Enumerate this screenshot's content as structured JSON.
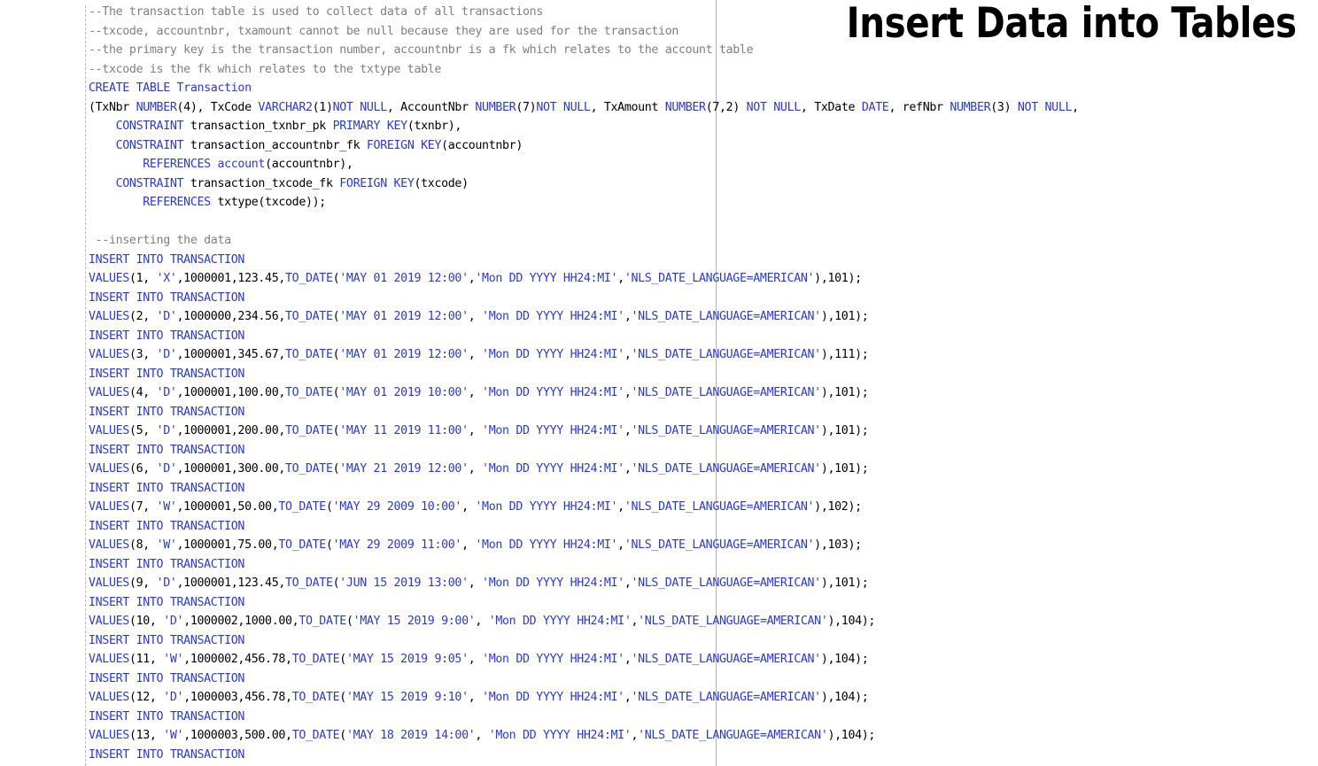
{
  "slide": {
    "title": "Insert Data into Tables"
  },
  "colors": {
    "keyword": "#2b3bc9",
    "comment": "#7f7f7f",
    "plain": "#000000",
    "background": "#ffffff"
  },
  "editor": {
    "lines": [
      [
        {
          "t": "comment",
          "v": "--The transaction table is used to collect data of all transactions"
        }
      ],
      [
        {
          "t": "comment",
          "v": "--txcode, accountnbr, txamount cannot be null because they are used for the transaction"
        }
      ],
      [
        {
          "t": "comment",
          "v": "--the primary key is the transaction number, accountnbr is a fk which relates to the account table"
        }
      ],
      [
        {
          "t": "comment",
          "v": "--txcode is the fk which relates to the txtype table"
        }
      ],
      [
        {
          "t": "kw",
          "v": "CREATE TABLE Transaction"
        }
      ],
      [
        {
          "t": "plain",
          "v": "(TxNbr "
        },
        {
          "t": "kw",
          "v": "NUMBER"
        },
        {
          "t": "plain",
          "v": "(4), TxCode "
        },
        {
          "t": "kw",
          "v": "VARCHAR2"
        },
        {
          "t": "plain",
          "v": "(1)"
        },
        {
          "t": "kw",
          "v": "NOT NULL"
        },
        {
          "t": "plain",
          "v": ", AccountNbr "
        },
        {
          "t": "kw",
          "v": "NUMBER"
        },
        {
          "t": "plain",
          "v": "(7)"
        },
        {
          "t": "kw",
          "v": "NOT NULL"
        },
        {
          "t": "plain",
          "v": ", TxAmount "
        },
        {
          "t": "kw",
          "v": "NUMBER"
        },
        {
          "t": "plain",
          "v": "(7,2) "
        },
        {
          "t": "kw",
          "v": "NOT NULL"
        },
        {
          "t": "plain",
          "v": ", TxDate "
        },
        {
          "t": "kw",
          "v": "DATE"
        },
        {
          "t": "plain",
          "v": ", refNbr "
        },
        {
          "t": "kw",
          "v": "NUMBER"
        },
        {
          "t": "plain",
          "v": "(3) "
        },
        {
          "t": "kw",
          "v": "NOT NULL"
        },
        {
          "t": "plain",
          "v": ","
        }
      ],
      [
        {
          "t": "plain",
          "v": "    "
        },
        {
          "t": "kw",
          "v": "CONSTRAINT"
        },
        {
          "t": "plain",
          "v": " transaction_txnbr_pk "
        },
        {
          "t": "kw",
          "v": "PRIMARY KEY"
        },
        {
          "t": "plain",
          "v": "(txnbr),"
        }
      ],
      [
        {
          "t": "plain",
          "v": "    "
        },
        {
          "t": "kw",
          "v": "CONSTRAINT"
        },
        {
          "t": "plain",
          "v": " transaction_accountnbr_fk "
        },
        {
          "t": "kw",
          "v": "FOREIGN KEY"
        },
        {
          "t": "plain",
          "v": "(accountnbr)"
        }
      ],
      [
        {
          "t": "plain",
          "v": "        "
        },
        {
          "t": "kw",
          "v": "REFERENCES"
        },
        {
          "t": "plain",
          "v": " "
        },
        {
          "t": "kw",
          "v": "account"
        },
        {
          "t": "plain",
          "v": "(accountnbr),"
        }
      ],
      [
        {
          "t": "plain",
          "v": "    "
        },
        {
          "t": "kw",
          "v": "CONSTRAINT"
        },
        {
          "t": "plain",
          "v": " transaction_txcode_fk "
        },
        {
          "t": "kw",
          "v": "FOREIGN KEY"
        },
        {
          "t": "plain",
          "v": "(txcode)"
        }
      ],
      [
        {
          "t": "plain",
          "v": "        "
        },
        {
          "t": "kw",
          "v": "REFERENCES"
        },
        {
          "t": "plain",
          "v": " txtype(txcode));"
        }
      ],
      [
        {
          "t": "plain",
          "v": ""
        }
      ],
      [
        {
          "t": "comment",
          "v": " --inserting the data"
        }
      ],
      [
        {
          "t": "kw",
          "v": "INSERT INTO TRANSACTION"
        }
      ],
      [
        {
          "t": "kw",
          "v": "VALUES"
        },
        {
          "t": "plain",
          "v": "(1, "
        },
        {
          "t": "str",
          "v": "'X'"
        },
        {
          "t": "plain",
          "v": ",1000001,123.45,"
        },
        {
          "t": "fn",
          "v": "TO_DATE"
        },
        {
          "t": "plain",
          "v": "("
        },
        {
          "t": "str",
          "v": "'MAY 01 2019 12:00'"
        },
        {
          "t": "plain",
          "v": ","
        },
        {
          "t": "str",
          "v": "'Mon DD YYYY HH24:MI'"
        },
        {
          "t": "plain",
          "v": ","
        },
        {
          "t": "str",
          "v": "'NLS_DATE_LANGUAGE=AMERICAN'"
        },
        {
          "t": "plain",
          "v": "),101);"
        }
      ],
      [
        {
          "t": "kw",
          "v": "INSERT INTO TRANSACTION"
        }
      ],
      [
        {
          "t": "kw",
          "v": "VALUES"
        },
        {
          "t": "plain",
          "v": "(2, "
        },
        {
          "t": "str",
          "v": "'D'"
        },
        {
          "t": "plain",
          "v": ",1000000,234.56,"
        },
        {
          "t": "fn",
          "v": "TO_DATE"
        },
        {
          "t": "plain",
          "v": "("
        },
        {
          "t": "str",
          "v": "'MAY 01 2019 12:00'"
        },
        {
          "t": "plain",
          "v": ", "
        },
        {
          "t": "str",
          "v": "'Mon DD YYYY HH24:MI'"
        },
        {
          "t": "plain",
          "v": ","
        },
        {
          "t": "str",
          "v": "'NLS_DATE_LANGUAGE=AMERICAN'"
        },
        {
          "t": "plain",
          "v": "),101);"
        }
      ],
      [
        {
          "t": "kw",
          "v": "INSERT INTO TRANSACTION"
        }
      ],
      [
        {
          "t": "kw",
          "v": "VALUES"
        },
        {
          "t": "plain",
          "v": "(3, "
        },
        {
          "t": "str",
          "v": "'D'"
        },
        {
          "t": "plain",
          "v": ",1000001,345.67,"
        },
        {
          "t": "fn",
          "v": "TO_DATE"
        },
        {
          "t": "plain",
          "v": "("
        },
        {
          "t": "str",
          "v": "'MAY 01 2019 12:00'"
        },
        {
          "t": "plain",
          "v": ", "
        },
        {
          "t": "str",
          "v": "'Mon DD YYYY HH24:MI'"
        },
        {
          "t": "plain",
          "v": ","
        },
        {
          "t": "str",
          "v": "'NLS_DATE_LANGUAGE=AMERICAN'"
        },
        {
          "t": "plain",
          "v": "),111);"
        }
      ],
      [
        {
          "t": "kw",
          "v": "INSERT INTO TRANSACTION"
        }
      ],
      [
        {
          "t": "kw",
          "v": "VALUES"
        },
        {
          "t": "plain",
          "v": "(4, "
        },
        {
          "t": "str",
          "v": "'D'"
        },
        {
          "t": "plain",
          "v": ",1000001,100.00,"
        },
        {
          "t": "fn",
          "v": "TO_DATE"
        },
        {
          "t": "plain",
          "v": "("
        },
        {
          "t": "str",
          "v": "'MAY 01 2019 10:00'"
        },
        {
          "t": "plain",
          "v": ", "
        },
        {
          "t": "str",
          "v": "'Mon DD YYYY HH24:MI'"
        },
        {
          "t": "plain",
          "v": ","
        },
        {
          "t": "str",
          "v": "'NLS_DATE_LANGUAGE=AMERICAN'"
        },
        {
          "t": "plain",
          "v": "),101);"
        }
      ],
      [
        {
          "t": "kw",
          "v": "INSERT INTO TRANSACTION"
        }
      ],
      [
        {
          "t": "kw",
          "v": "VALUES"
        },
        {
          "t": "plain",
          "v": "(5, "
        },
        {
          "t": "str",
          "v": "'D'"
        },
        {
          "t": "plain",
          "v": ",1000001,200.00,"
        },
        {
          "t": "fn",
          "v": "TO_DATE"
        },
        {
          "t": "plain",
          "v": "("
        },
        {
          "t": "str",
          "v": "'MAY 11 2019 11:00'"
        },
        {
          "t": "plain",
          "v": ", "
        },
        {
          "t": "str",
          "v": "'Mon DD YYYY HH24:MI'"
        },
        {
          "t": "plain",
          "v": ","
        },
        {
          "t": "str",
          "v": "'NLS_DATE_LANGUAGE=AMERICAN'"
        },
        {
          "t": "plain",
          "v": "),101);"
        }
      ],
      [
        {
          "t": "kw",
          "v": "INSERT INTO TRANSACTION"
        }
      ],
      [
        {
          "t": "kw",
          "v": "VALUES"
        },
        {
          "t": "plain",
          "v": "(6, "
        },
        {
          "t": "str",
          "v": "'D'"
        },
        {
          "t": "plain",
          "v": ",1000001,300.00,"
        },
        {
          "t": "fn",
          "v": "TO_DATE"
        },
        {
          "t": "plain",
          "v": "("
        },
        {
          "t": "str",
          "v": "'MAY 21 2019 12:00'"
        },
        {
          "t": "plain",
          "v": ", "
        },
        {
          "t": "str",
          "v": "'Mon DD YYYY HH24:MI'"
        },
        {
          "t": "plain",
          "v": ","
        },
        {
          "t": "str",
          "v": "'NLS_DATE_LANGUAGE=AMERICAN'"
        },
        {
          "t": "plain",
          "v": "),101);"
        }
      ],
      [
        {
          "t": "kw",
          "v": "INSERT INTO TRANSACTION"
        }
      ],
      [
        {
          "t": "kw",
          "v": "VALUES"
        },
        {
          "t": "plain",
          "v": "(7, "
        },
        {
          "t": "str",
          "v": "'W'"
        },
        {
          "t": "plain",
          "v": ",1000001,50.00,"
        },
        {
          "t": "fn",
          "v": "TO_DATE"
        },
        {
          "t": "plain",
          "v": "("
        },
        {
          "t": "str",
          "v": "'MAY 29 2009 10:00'"
        },
        {
          "t": "plain",
          "v": ", "
        },
        {
          "t": "str",
          "v": "'Mon DD YYYY HH24:MI'"
        },
        {
          "t": "plain",
          "v": ","
        },
        {
          "t": "str",
          "v": "'NLS_DATE_LANGUAGE=AMERICAN'"
        },
        {
          "t": "plain",
          "v": "),102);"
        }
      ],
      [
        {
          "t": "kw",
          "v": "INSERT INTO TRANSACTION"
        }
      ],
      [
        {
          "t": "kw",
          "v": "VALUES"
        },
        {
          "t": "plain",
          "v": "(8, "
        },
        {
          "t": "str",
          "v": "'W'"
        },
        {
          "t": "plain",
          "v": ",1000001,75.00,"
        },
        {
          "t": "fn",
          "v": "TO_DATE"
        },
        {
          "t": "plain",
          "v": "("
        },
        {
          "t": "str",
          "v": "'MAY 29 2009 11:00'"
        },
        {
          "t": "plain",
          "v": ", "
        },
        {
          "t": "str",
          "v": "'Mon DD YYYY HH24:MI'"
        },
        {
          "t": "plain",
          "v": ","
        },
        {
          "t": "str",
          "v": "'NLS_DATE_LANGUAGE=AMERICAN'"
        },
        {
          "t": "plain",
          "v": "),103);"
        }
      ],
      [
        {
          "t": "kw",
          "v": "INSERT INTO TRANSACTION"
        }
      ],
      [
        {
          "t": "kw",
          "v": "VALUES"
        },
        {
          "t": "plain",
          "v": "(9, "
        },
        {
          "t": "str",
          "v": "'D'"
        },
        {
          "t": "plain",
          "v": ",1000001,123.45,"
        },
        {
          "t": "fn",
          "v": "TO_DATE"
        },
        {
          "t": "plain",
          "v": "("
        },
        {
          "t": "str",
          "v": "'JUN 15 2019 13:00'"
        },
        {
          "t": "plain",
          "v": ", "
        },
        {
          "t": "str",
          "v": "'Mon DD YYYY HH24:MI'"
        },
        {
          "t": "plain",
          "v": ","
        },
        {
          "t": "str",
          "v": "'NLS_DATE_LANGUAGE=AMERICAN'"
        },
        {
          "t": "plain",
          "v": "),101);"
        }
      ],
      [
        {
          "t": "kw",
          "v": "INSERT INTO TRANSACTION"
        }
      ],
      [
        {
          "t": "kw",
          "v": "VALUES"
        },
        {
          "t": "plain",
          "v": "(10, "
        },
        {
          "t": "str",
          "v": "'D'"
        },
        {
          "t": "plain",
          "v": ",1000002,1000.00,"
        },
        {
          "t": "fn",
          "v": "TO_DATE"
        },
        {
          "t": "plain",
          "v": "("
        },
        {
          "t": "str",
          "v": "'MAY 15 2019 9:00'"
        },
        {
          "t": "plain",
          "v": ", "
        },
        {
          "t": "str",
          "v": "'Mon DD YYYY HH24:MI'"
        },
        {
          "t": "plain",
          "v": ","
        },
        {
          "t": "str",
          "v": "'NLS_DATE_LANGUAGE=AMERICAN'"
        },
        {
          "t": "plain",
          "v": "),104);"
        }
      ],
      [
        {
          "t": "kw",
          "v": "INSERT INTO TRANSACTION"
        }
      ],
      [
        {
          "t": "kw",
          "v": "VALUES"
        },
        {
          "t": "plain",
          "v": "(11, "
        },
        {
          "t": "str",
          "v": "'W'"
        },
        {
          "t": "plain",
          "v": ",1000002,456.78,"
        },
        {
          "t": "fn",
          "v": "TO_DATE"
        },
        {
          "t": "plain",
          "v": "("
        },
        {
          "t": "str",
          "v": "'MAY 15 2019 9:05'"
        },
        {
          "t": "plain",
          "v": ", "
        },
        {
          "t": "str",
          "v": "'Mon DD YYYY HH24:MI'"
        },
        {
          "t": "plain",
          "v": ","
        },
        {
          "t": "str",
          "v": "'NLS_DATE_LANGUAGE=AMERICAN'"
        },
        {
          "t": "plain",
          "v": "),104);"
        }
      ],
      [
        {
          "t": "kw",
          "v": "INSERT INTO TRANSACTION"
        }
      ],
      [
        {
          "t": "kw",
          "v": "VALUES"
        },
        {
          "t": "plain",
          "v": "(12, "
        },
        {
          "t": "str",
          "v": "'D'"
        },
        {
          "t": "plain",
          "v": ",1000003,456.78,"
        },
        {
          "t": "fn",
          "v": "TO_DATE"
        },
        {
          "t": "plain",
          "v": "("
        },
        {
          "t": "str",
          "v": "'MAY 15 2019 9:10'"
        },
        {
          "t": "plain",
          "v": ", "
        },
        {
          "t": "str",
          "v": "'Mon DD YYYY HH24:MI'"
        },
        {
          "t": "plain",
          "v": ","
        },
        {
          "t": "str",
          "v": "'NLS_DATE_LANGUAGE=AMERICAN'"
        },
        {
          "t": "plain",
          "v": "),104);"
        }
      ],
      [
        {
          "t": "kw",
          "v": "INSERT INTO TRANSACTION"
        }
      ],
      [
        {
          "t": "kw",
          "v": "VALUES"
        },
        {
          "t": "plain",
          "v": "(13, "
        },
        {
          "t": "str",
          "v": "'W'"
        },
        {
          "t": "plain",
          "v": ",1000003,500.00,"
        },
        {
          "t": "fn",
          "v": "TO_DATE"
        },
        {
          "t": "plain",
          "v": "("
        },
        {
          "t": "str",
          "v": "'MAY 18 2019 14:00'"
        },
        {
          "t": "plain",
          "v": ", "
        },
        {
          "t": "str",
          "v": "'Mon DD YYYY HH24:MI'"
        },
        {
          "t": "plain",
          "v": ","
        },
        {
          "t": "str",
          "v": "'NLS_DATE_LANGUAGE=AMERICAN'"
        },
        {
          "t": "plain",
          "v": "),104);"
        }
      ],
      [
        {
          "t": "kw",
          "v": "INSERT INTO TRANSACTION"
        }
      ]
    ]
  }
}
